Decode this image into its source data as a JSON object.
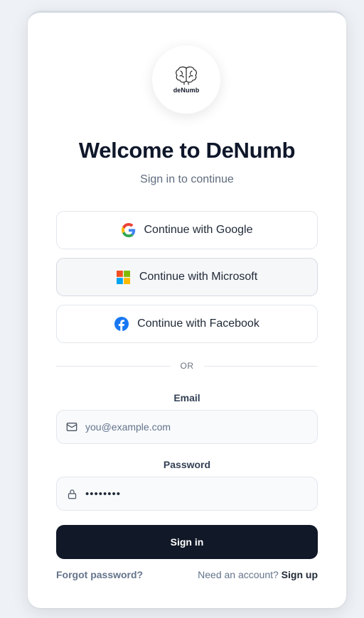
{
  "brand": {
    "logo_text": "deNumb",
    "logo_icon": "brain-icon"
  },
  "header": {
    "title": "Welcome to DeNumb",
    "subtitle": "Sign in to continue"
  },
  "providers": [
    {
      "label": "Continue with Google",
      "icon": "google-icon"
    },
    {
      "label": "Continue with Microsoft",
      "icon": "microsoft-icon"
    },
    {
      "label": "Continue with Facebook",
      "icon": "facebook-icon"
    }
  ],
  "divider": {
    "text": "OR"
  },
  "form": {
    "email": {
      "label": "Email",
      "placeholder": "you@example.com",
      "icon": "mail-icon"
    },
    "password": {
      "label": "Password",
      "value": "••••••••",
      "icon": "lock-icon"
    },
    "submit_label": "Sign in"
  },
  "footer": {
    "forgot_label": "Forgot password?",
    "account_prompt": "Need an account?",
    "signup_label": "Sign up"
  },
  "colors": {
    "primary": "#111827",
    "google_blue": "#4285F4",
    "google_red": "#EA4335",
    "google_yellow": "#FBBC05",
    "google_green": "#34A853",
    "ms_red": "#F25022",
    "ms_green": "#7FBA00",
    "ms_blue": "#00A4EF",
    "ms_yellow": "#FFB900",
    "facebook_blue": "#1877F2"
  }
}
